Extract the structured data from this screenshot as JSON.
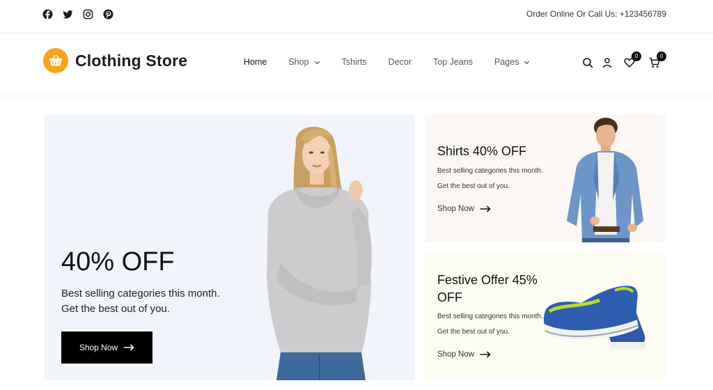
{
  "topbar": {
    "social_icons": [
      "facebook-icon",
      "twitter-icon",
      "instagram-icon",
      "pinterest-icon"
    ],
    "order_text": "Order Online Or Call Us: +123456789"
  },
  "header": {
    "brand": "Clothing Store",
    "brand_color": "#f6a21c",
    "nav": [
      {
        "label": "Home",
        "has_dropdown": false,
        "active": true
      },
      {
        "label": "Shop",
        "has_dropdown": true
      },
      {
        "label": "Tshirts",
        "has_dropdown": false
      },
      {
        "label": "Decor",
        "has_dropdown": false
      },
      {
        "label": "Top Jeans",
        "has_dropdown": false
      },
      {
        "label": "Pages",
        "has_dropdown": true
      }
    ],
    "wishlist_count": "0",
    "cart_count": "0"
  },
  "hero": {
    "title": "40% OFF",
    "description": "Best selling categories this month. Get the best out of you.",
    "button_label": "Shop Now"
  },
  "promos": [
    {
      "title": "Shirts 40% OFF",
      "description": "Best selling categories this month. Get the best out of you.",
      "link_label": "Shop Now"
    },
    {
      "title": "Festive Offer 45% OFF",
      "description": "Best selling categories this month. Get the best out of you.",
      "link_label": "Shop Now"
    }
  ]
}
